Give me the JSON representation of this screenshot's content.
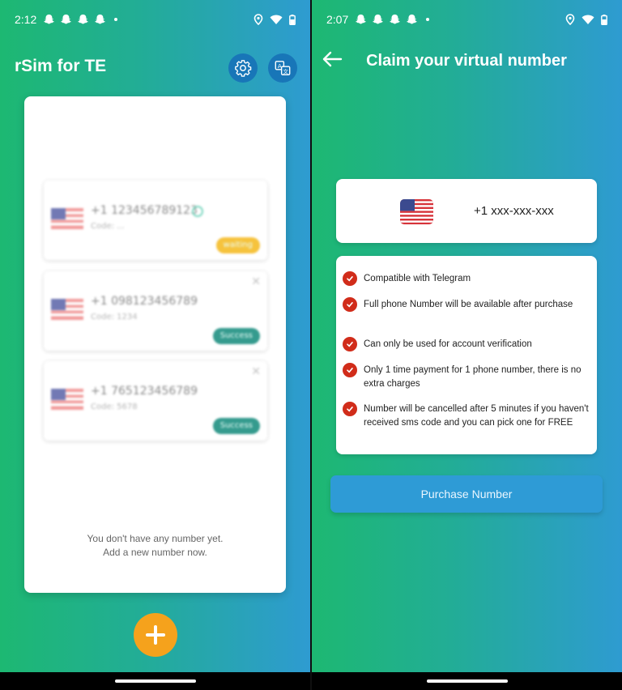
{
  "left_screen": {
    "status": {
      "time": "2:12"
    },
    "header": {
      "title": "rSim for TE",
      "settings_icon": "gear-icon",
      "translate_icon": "translate-icon"
    },
    "samples": [
      {
        "number": "+1 1234567891​23",
        "code": "Code: ...",
        "badge": "waiting",
        "badge_color": "#f5b91c"
      },
      {
        "number": "+1 0981234567​89",
        "code": "Code: 1234",
        "badge": "Success",
        "badge_color": "#128a7b"
      },
      {
        "number": "+1 7651234567​89",
        "code": "Code: 5678",
        "badge": "Success",
        "badge_color": "#128a7b"
      }
    ],
    "empty_state": {
      "line1": "You don't have any number yet.",
      "line2": "Add a new number now."
    },
    "fab_icon": "plus-icon"
  },
  "right_screen": {
    "status": {
      "time": "2:07"
    },
    "title": "Claim your virtual number",
    "number_card": {
      "number": "+1 xxx-xxx-xxx",
      "flag_icon": "us-flag-icon"
    },
    "features": [
      "Compatible with Telegram",
      "Full phone Number will be available after purchase",
      "Can only be used for account verification",
      "Only 1 time payment for 1 phone number, there is no extra charges",
      "Number will be cancelled after 5 minutes if you haven't received sms code and you can pick one for FREE"
    ],
    "purchase_button": "Purchase Number"
  },
  "colors": {
    "gradient_start": "#1db872",
    "gradient_end": "#2e9bd1",
    "accent_orange": "#f5a21c",
    "check_red": "#d12c1a",
    "button_blue": "#2e9bd6"
  }
}
